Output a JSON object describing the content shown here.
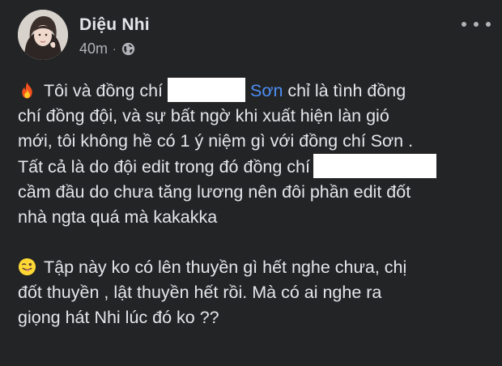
{
  "post": {
    "author": "Diệu Nhi",
    "time": "40m",
    "separator": "·",
    "privacy_icon": "globe-icon",
    "more_icon": "more-horizontal-icon",
    "paragraph1": {
      "emoji": "fire-emoji",
      "l1_a": "Tôi và đồng chí",
      "l1_link": "Sơn",
      "l1_b": " chỉ là tình đồng",
      "l2": "chí đồng đội, và sự bất ngờ khi xuất hiện làn gió",
      "l3": "mới, tôi không hề có 1 ý niệm gì với đồng chí Sơn .",
      "l4_a": "Tất cả là do đội edit trong đó đồng chí",
      "l5": "cầm đầu do chưa tăng lương nên đôi phần edit đốt",
      "l6": "nhà ngta quá mà kakakka"
    },
    "paragraph2": {
      "emoji": "winking-tongue-emoji",
      "l1": "Tập này ko có lên thuyền gì hết nghe chưa, chị",
      "l2": "đốt thuyền , lật thuyền hết rồi. Mà có ai nghe ra",
      "l3": "giọng hát Nhi lúc đó ko ??"
    }
  },
  "colors": {
    "background": "#232425",
    "text": "#e4e6eb",
    "secondary": "#b0b3b8",
    "link": "#4c8ef6",
    "redaction": "#ffffff"
  }
}
